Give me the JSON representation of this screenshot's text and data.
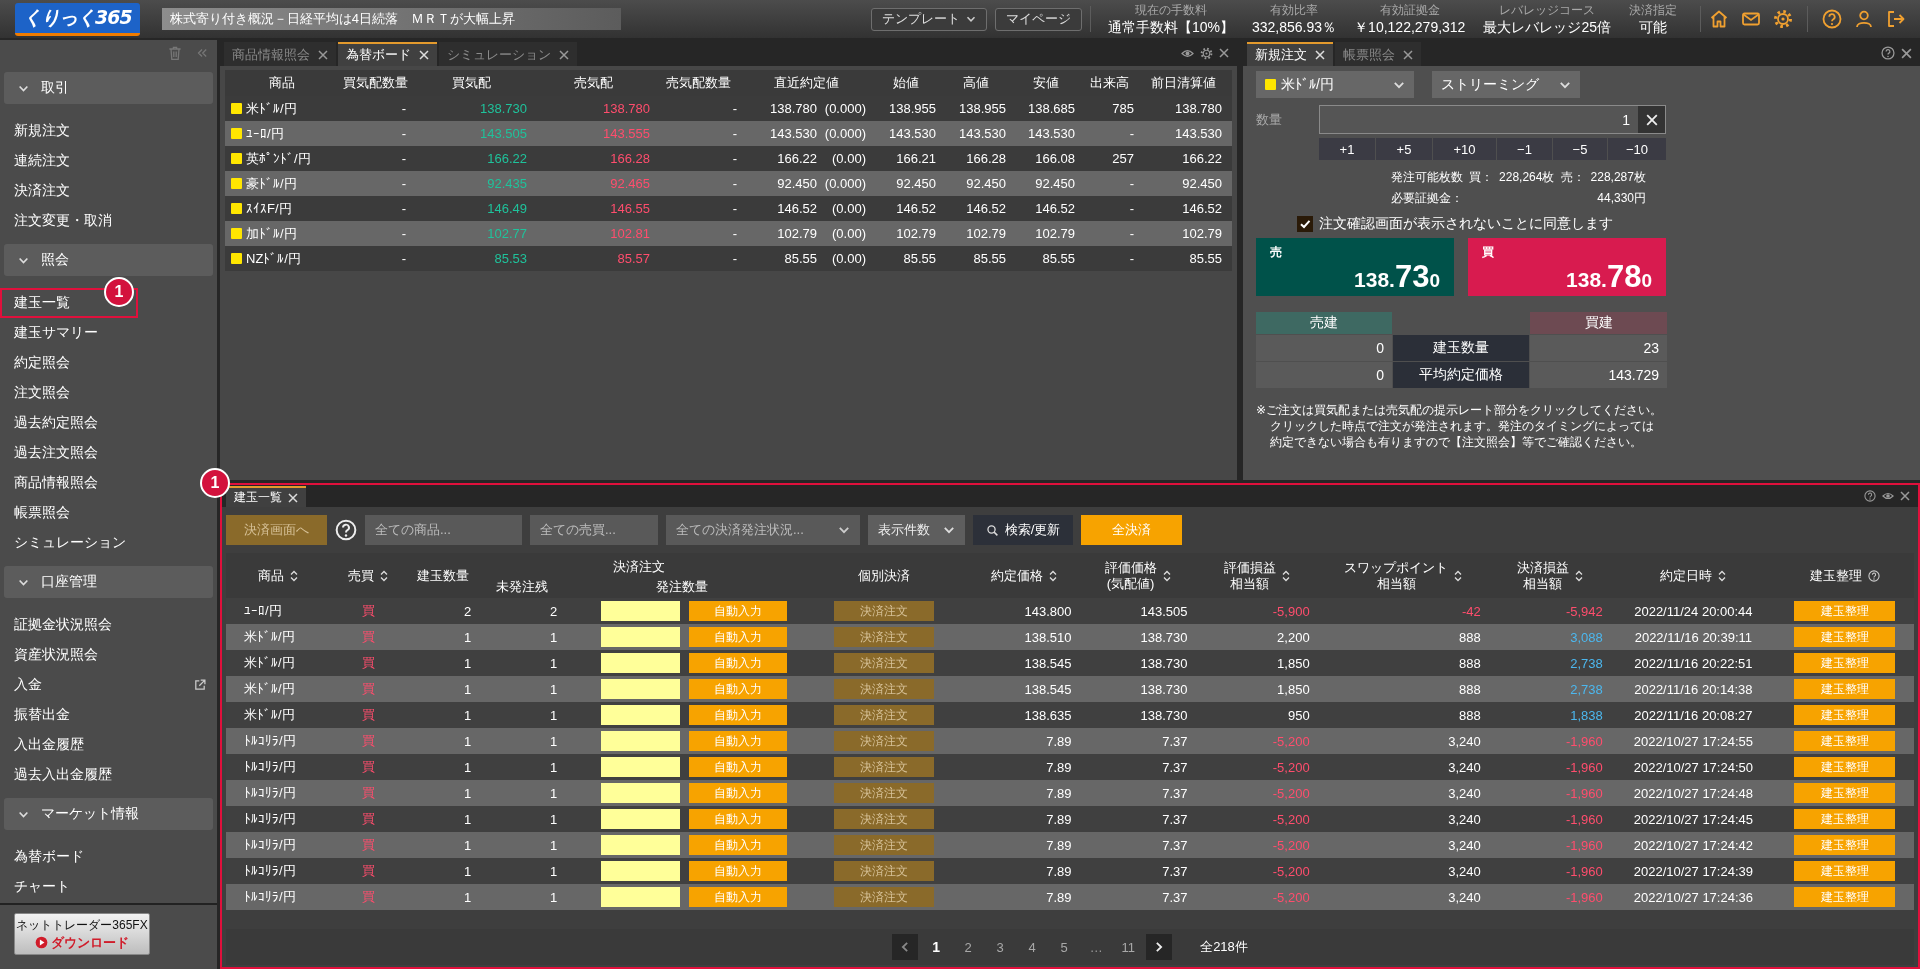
{
  "topbar": {
    "logo": "くりっく365",
    "news": "株式寄り付き概況－日経平均は4日続落　ＭＲＴが大幅上昇",
    "menus": [
      {
        "label": "テンプレート",
        "dropdown": true
      },
      {
        "label": "マイページ",
        "dropdown": false
      }
    ],
    "stats": [
      {
        "label": "現在の手数料",
        "value": "通常手数料【10%】"
      },
      {
        "label": "有効比率",
        "value": "332,856.93％"
      },
      {
        "label": "有効証拠金",
        "value": "￥10,122,279,312"
      },
      {
        "label": "レバレッジコース",
        "value": "最大レバレッジ25倍"
      },
      {
        "label": "決済指定",
        "value": "可能"
      }
    ]
  },
  "sidebar": {
    "groups": [
      {
        "title": "取引",
        "expanded": true,
        "items": [
          {
            "label": "新規注文",
            "kind": "page"
          },
          {
            "label": "連続注文",
            "kind": "page"
          },
          {
            "label": "決済注文",
            "kind": "page"
          },
          {
            "label": "注文変更・取消",
            "kind": "page"
          }
        ]
      },
      {
        "title": "照会",
        "expanded": true,
        "items": [
          {
            "label": "建玉一覧",
            "kind": "page",
            "callout": "1"
          },
          {
            "label": "建玉サマリー",
            "kind": "page"
          },
          {
            "label": "約定照会",
            "kind": "page"
          },
          {
            "label": "注文照会",
            "kind": "page"
          },
          {
            "label": "過去約定照会",
            "kind": "page"
          },
          {
            "label": "過去注文照会",
            "kind": "page"
          },
          {
            "label": "商品情報照会",
            "kind": "page"
          },
          {
            "label": "帳票照会",
            "kind": "page"
          },
          {
            "label": "シミュレーション",
            "kind": "page"
          }
        ]
      },
      {
        "title": "口座管理",
        "expanded": true,
        "items": [
          {
            "label": "証拠金状況照会",
            "kind": "page"
          },
          {
            "label": "資産状況照会",
            "kind": "page"
          },
          {
            "label": "入金",
            "kind": "external"
          },
          {
            "label": "振替出金",
            "kind": "page"
          },
          {
            "label": "入出金履歴",
            "kind": "page"
          },
          {
            "label": "過去入出金履歴",
            "kind": "page"
          }
        ]
      },
      {
        "title": "マーケット情報",
        "expanded": true,
        "items": [
          {
            "label": "為替ボード",
            "kind": "page"
          },
          {
            "label": "チャート",
            "kind": "page"
          }
        ]
      }
    ],
    "banner": {
      "title": "ネットトレーダー365FX",
      "action": "ダウンロード"
    }
  },
  "rate_board": {
    "tabs": [
      {
        "label": "商品情報照会",
        "selected": false
      },
      {
        "label": "為替ボード",
        "selected": true
      },
      {
        "label": "シミュレーション",
        "selected": false
      }
    ],
    "columns": [
      "商品",
      "買気配数量",
      "買気配",
      "売気配",
      "売気配数量",
      "直近約定値",
      "始値",
      "高値",
      "安値",
      "出来高",
      "前日清算値"
    ],
    "rows": [
      {
        "name": "米ﾄﾞﾙ/円",
        "bid_qty": "-",
        "bid": "138.730",
        "ask": "138.780",
        "ask_qty": "-",
        "last": "138.780",
        "change": "(0.000)",
        "open": "138.955",
        "high": "138.955",
        "low": "138.685",
        "volume": "785",
        "prev": "138.780"
      },
      {
        "name": "ﾕｰﾛ/円",
        "bid_qty": "-",
        "bid": "143.505",
        "ask": "143.555",
        "ask_qty": "-",
        "last": "143.530",
        "change": "(0.000)",
        "open": "143.530",
        "high": "143.530",
        "low": "143.530",
        "volume": "-",
        "prev": "143.530"
      },
      {
        "name": "英ﾎﾟﾝﾄﾞ/円",
        "bid_qty": "-",
        "bid": "166.22",
        "ask": "166.28",
        "ask_qty": "-",
        "last": "166.22",
        "change": "(0.00)",
        "open": "166.21",
        "high": "166.28",
        "low": "166.08",
        "volume": "257",
        "prev": "166.22"
      },
      {
        "name": "豪ﾄﾞﾙ/円",
        "bid_qty": "-",
        "bid": "92.435",
        "ask": "92.465",
        "ask_qty": "-",
        "last": "92.450",
        "change": "(0.000)",
        "open": "92.450",
        "high": "92.450",
        "low": "92.450",
        "volume": "-",
        "prev": "92.450"
      },
      {
        "name": "ｽｲｽF/円",
        "bid_qty": "-",
        "bid": "146.49",
        "ask": "146.55",
        "ask_qty": "-",
        "last": "146.52",
        "change": "(0.00)",
        "open": "146.52",
        "high": "146.52",
        "low": "146.52",
        "volume": "-",
        "prev": "146.52"
      },
      {
        "name": "加ﾄﾞﾙ/円",
        "bid_qty": "-",
        "bid": "102.77",
        "ask": "102.81",
        "ask_qty": "-",
        "last": "102.79",
        "change": "(0.00)",
        "open": "102.79",
        "high": "102.79",
        "low": "102.79",
        "volume": "-",
        "prev": "102.79"
      },
      {
        "name": "NZﾄﾞﾙ/円",
        "bid_qty": "-",
        "bid": "85.53",
        "ask": "85.57",
        "ask_qty": "-",
        "last": "85.55",
        "change": "(0.00)",
        "open": "85.55",
        "high": "85.55",
        "low": "85.55",
        "volume": "-",
        "prev": "85.55"
      }
    ]
  },
  "order": {
    "tabs": [
      {
        "label": "新規注文",
        "selected": true
      },
      {
        "label": "帳票照会",
        "selected": false
      }
    ],
    "pair": "米ﾄﾞﾙ/円",
    "mode": "ストリーミング",
    "quantity_label": "数量",
    "quantity": "1",
    "steps": [
      "+1",
      "+5",
      "+10",
      "−1",
      "−5",
      "−10"
    ],
    "capacity": {
      "label": "発注可能枚数",
      "buy_label": "買：",
      "buy": "228,264枚",
      "sell_label": "売：",
      "sell": "228,287枚"
    },
    "margin": {
      "label": "必要証拠金：",
      "value": "44,330円"
    },
    "confirm": {
      "label": "注文確認画面が表示されないことに同意します",
      "checked": true
    },
    "quotes": [
      {
        "side": "売",
        "kind": "sell",
        "price_head": "138.",
        "price_big": "73",
        "price_tail": "0"
      },
      {
        "side": "買",
        "kind": "buy",
        "price_head": "138.",
        "price_big": "78",
        "price_tail": "0"
      }
    ],
    "summary": {
      "sell_header": "売建",
      "buy_header": "買建",
      "rows": [
        {
          "label": "建玉数量",
          "sell": "0",
          "buy": "23"
        },
        {
          "label": "平均約定価格",
          "sell": "0",
          "buy": "143.729"
        }
      ]
    },
    "note": [
      "※ご注文は買気配または売気配の提示レート部分をクリックしてください。",
      "クリックした時点で注文が発注されます。発注のタイミングによっては",
      "約定できない場合も有りますので【注文照会】等でご確認ください。"
    ]
  },
  "positions": {
    "callout": "1",
    "tabs": [
      {
        "label": "建玉一覧",
        "selected": true
      }
    ],
    "toolbar": {
      "settle_screen": {
        "label": "決済画面へ",
        "disabled": true
      },
      "filters": [
        {
          "text": "全ての商品...",
          "kind": "input"
        },
        {
          "text": "全ての売買...",
          "kind": "input"
        },
        {
          "text": "全ての決済発注状況...",
          "kind": "select"
        }
      ],
      "page_size": "表示件数",
      "search": "検索/更新",
      "close_all": "全決済"
    },
    "columns": [
      {
        "label": "商品",
        "kind": "sort"
      },
      {
        "label": "売買",
        "kind": "sort"
      },
      {
        "label": "建玉数量",
        "kind": "plain"
      },
      {
        "label": "決済注文",
        "children": [
          {
            "label": "未発注残"
          },
          {
            "label": "発注数量"
          }
        ]
      },
      {
        "label": "個別決済",
        "kind": "plain"
      },
      {
        "label": "約定価格",
        "kind": "sort"
      },
      {
        "label": "評価価格",
        "sub": "(気配値)",
        "kind": "sort"
      },
      {
        "label": "評価損益",
        "sub": "相当額",
        "kind": "sort"
      },
      {
        "label": "スワップポイント",
        "sub": "相当額",
        "kind": "sort"
      },
      {
        "label": "決済損益",
        "sub": "相当額",
        "kind": "sort"
      },
      {
        "label": "約定日時",
        "kind": "sort"
      },
      {
        "label": "建玉整理",
        "kind": "help"
      }
    ],
    "rows": [
      {
        "product": "ﾕｰﾛ/円",
        "side": "買",
        "qty": "2",
        "remaining": "2",
        "auto": "自動入力",
        "settle": {
          "label": "決済注文",
          "disabled": true
        },
        "price": "143.800",
        "eval": "143.505",
        "pl": {
          "text": "-5,900",
          "color": "#ff4d6d"
        },
        "swap": {
          "text": "-42",
          "color": "#ff4d6d"
        },
        "settle_pl": {
          "text": "-5,942",
          "color": "#ff4d6d"
        },
        "time": "2022/11/24 20:00:44",
        "tidy": "建玉整理"
      },
      {
        "product": "米ﾄﾞﾙ/円",
        "side": "買",
        "qty": "1",
        "remaining": "1",
        "auto": "自動入力",
        "settle": {
          "label": "決済注文",
          "disabled": true
        },
        "price": "138.510",
        "eval": "138.730",
        "pl": {
          "text": "2,200",
          "color": "#ffffff"
        },
        "swap": {
          "text": "888",
          "color": "#ffffff"
        },
        "settle_pl": {
          "text": "3,088",
          "color": "#4cb7ee"
        },
        "time": "2022/11/16 20:39:11",
        "tidy": "建玉整理"
      },
      {
        "product": "米ﾄﾞﾙ/円",
        "side": "買",
        "qty": "1",
        "remaining": "1",
        "auto": "自動入力",
        "settle": {
          "label": "決済注文",
          "disabled": true
        },
        "price": "138.545",
        "eval": "138.730",
        "pl": {
          "text": "1,850",
          "color": "#ffffff"
        },
        "swap": {
          "text": "888",
          "color": "#ffffff"
        },
        "settle_pl": {
          "text": "2,738",
          "color": "#4cb7ee"
        },
        "time": "2022/11/16 20:22:51",
        "tidy": "建玉整理"
      },
      {
        "product": "米ﾄﾞﾙ/円",
        "side": "買",
        "qty": "1",
        "remaining": "1",
        "auto": "自動入力",
        "settle": {
          "label": "決済注文",
          "disabled": true
        },
        "price": "138.545",
        "eval": "138.730",
        "pl": {
          "text": "1,850",
          "color": "#ffffff"
        },
        "swap": {
          "text": "888",
          "color": "#ffffff"
        },
        "settle_pl": {
          "text": "2,738",
          "color": "#4cb7ee"
        },
        "time": "2022/11/16 20:14:38",
        "tidy": "建玉整理"
      },
      {
        "product": "米ﾄﾞﾙ/円",
        "side": "買",
        "qty": "1",
        "remaining": "1",
        "auto": "自動入力",
        "settle": {
          "label": "決済注文",
          "disabled": true
        },
        "price": "138.635",
        "eval": "138.730",
        "pl": {
          "text": "950",
          "color": "#ffffff"
        },
        "swap": {
          "text": "888",
          "color": "#ffffff"
        },
        "settle_pl": {
          "text": "1,838",
          "color": "#4cb7ee"
        },
        "time": "2022/11/16 20:08:27",
        "tidy": "建玉整理"
      },
      {
        "product": "ﾄﾙｺﾘﾗ/円",
        "side": "買",
        "qty": "1",
        "remaining": "1",
        "auto": "自動入力",
        "settle": {
          "label": "決済注文",
          "disabled": true
        },
        "price": "7.89",
        "eval": "7.37",
        "pl": {
          "text": "-5,200",
          "color": "#ff4d6d"
        },
        "swap": {
          "text": "3,240",
          "color": "#ffffff"
        },
        "settle_pl": {
          "text": "-1,960",
          "color": "#ff4d6d"
        },
        "time": "2022/10/27 17:24:55",
        "tidy": "建玉整理"
      },
      {
        "product": "ﾄﾙｺﾘﾗ/円",
        "side": "買",
        "qty": "1",
        "remaining": "1",
        "auto": "自動入力",
        "settle": {
          "label": "決済注文",
          "disabled": true
        },
        "price": "7.89",
        "eval": "7.37",
        "pl": {
          "text": "-5,200",
          "color": "#ff4d6d"
        },
        "swap": {
          "text": "3,240",
          "color": "#ffffff"
        },
        "settle_pl": {
          "text": "-1,960",
          "color": "#ff4d6d"
        },
        "time": "2022/10/27 17:24:50",
        "tidy": "建玉整理"
      },
      {
        "product": "ﾄﾙｺﾘﾗ/円",
        "side": "買",
        "qty": "1",
        "remaining": "1",
        "auto": "自動入力",
        "settle": {
          "label": "決済注文",
          "disabled": true
        },
        "price": "7.89",
        "eval": "7.37",
        "pl": {
          "text": "-5,200",
          "color": "#ff4d6d"
        },
        "swap": {
          "text": "3,240",
          "color": "#ffffff"
        },
        "settle_pl": {
          "text": "-1,960",
          "color": "#ff4d6d"
        },
        "time": "2022/10/27 17:24:48",
        "tidy": "建玉整理"
      },
      {
        "product": "ﾄﾙｺﾘﾗ/円",
        "side": "買",
        "qty": "1",
        "remaining": "1",
        "auto": "自動入力",
        "settle": {
          "label": "決済注文",
          "disabled": true
        },
        "price": "7.89",
        "eval": "7.37",
        "pl": {
          "text": "-5,200",
          "color": "#ff4d6d"
        },
        "swap": {
          "text": "3,240",
          "color": "#ffffff"
        },
        "settle_pl": {
          "text": "-1,960",
          "color": "#ff4d6d"
        },
        "time": "2022/10/27 17:24:45",
        "tidy": "建玉整理"
      },
      {
        "product": "ﾄﾙｺﾘﾗ/円",
        "side": "買",
        "qty": "1",
        "remaining": "1",
        "auto": "自動入力",
        "settle": {
          "label": "決済注文",
          "disabled": true
        },
        "price": "7.89",
        "eval": "7.37",
        "pl": {
          "text": "-5,200",
          "color": "#ff4d6d"
        },
        "swap": {
          "text": "3,240",
          "color": "#ffffff"
        },
        "settle_pl": {
          "text": "-1,960",
          "color": "#ff4d6d"
        },
        "time": "2022/10/27 17:24:42",
        "tidy": "建玉整理"
      },
      {
        "product": "ﾄﾙｺﾘﾗ/円",
        "side": "買",
        "qty": "1",
        "remaining": "1",
        "auto": "自動入力",
        "settle": {
          "label": "決済注文",
          "disabled": true
        },
        "price": "7.89",
        "eval": "7.37",
        "pl": {
          "text": "-5,200",
          "color": "#ff4d6d"
        },
        "swap": {
          "text": "3,240",
          "color": "#ffffff"
        },
        "settle_pl": {
          "text": "-1,960",
          "color": "#ff4d6d"
        },
        "time": "2022/10/27 17:24:39",
        "tidy": "建玉整理"
      },
      {
        "product": "ﾄﾙｺﾘﾗ/円",
        "side": "買",
        "qty": "1",
        "remaining": "1",
        "auto": "自動入力",
        "settle": {
          "label": "決済注文",
          "disabled": true
        },
        "price": "7.89",
        "eval": "7.37",
        "pl": {
          "text": "-5,200",
          "color": "#ff4d6d"
        },
        "swap": {
          "text": "3,240",
          "color": "#ffffff"
        },
        "settle_pl": {
          "text": "-1,960",
          "color": "#ff4d6d"
        },
        "time": "2022/10/27 17:24:36",
        "tidy": "建玉整理"
      }
    ],
    "pagination": {
      "pages": [
        {
          "label": "1",
          "kind": "page",
          "selected": true
        },
        {
          "label": "2",
          "kind": "page",
          "selected": false
        },
        {
          "label": "3",
          "kind": "page",
          "selected": false
        },
        {
          "label": "4",
          "kind": "page",
          "selected": false
        },
        {
          "label": "5",
          "kind": "page",
          "selected": false
        },
        {
          "label": "…",
          "kind": "gap",
          "selected": false
        },
        {
          "label": "11",
          "kind": "page",
          "selected": false
        }
      ],
      "total": "全218件"
    }
  }
}
